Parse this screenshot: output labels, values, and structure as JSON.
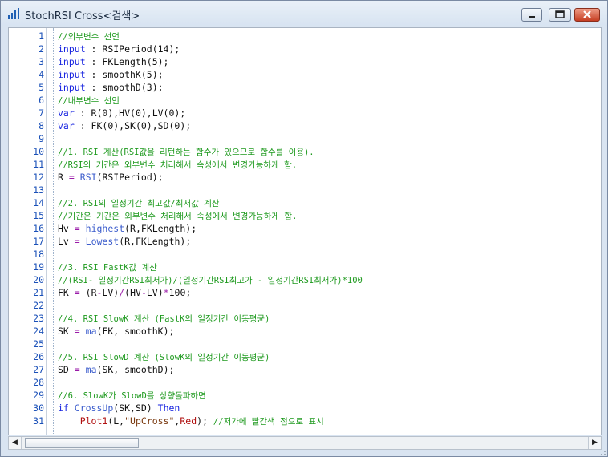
{
  "window": {
    "title": "StochRSI Cross<검색>",
    "icons": {
      "app": "bar-chart-icon",
      "minimize": "minimize-icon",
      "maximize": "maximize-icon",
      "close": "close-icon"
    }
  },
  "editor": {
    "lines": [
      {
        "n": "1",
        "parts": [
          [
            "cm",
            "//외부변수 선언"
          ]
        ]
      },
      {
        "n": "2",
        "parts": [
          [
            "kw",
            "input"
          ],
          [
            "pl",
            " : RSIPeriod(14);"
          ]
        ]
      },
      {
        "n": "3",
        "parts": [
          [
            "kw",
            "input"
          ],
          [
            "pl",
            " : FKLength(5);"
          ]
        ]
      },
      {
        "n": "4",
        "parts": [
          [
            "kw",
            "input"
          ],
          [
            "pl",
            " : smoothK(5);"
          ]
        ]
      },
      {
        "n": "5",
        "parts": [
          [
            "kw",
            "input"
          ],
          [
            "pl",
            " : smoothD(3);"
          ]
        ]
      },
      {
        "n": "6",
        "parts": [
          [
            "cm",
            "//내부변수 선언"
          ]
        ]
      },
      {
        "n": "7",
        "parts": [
          [
            "kw",
            "var"
          ],
          [
            "pl",
            " : R(0),HV(0),LV(0);"
          ]
        ]
      },
      {
        "n": "8",
        "parts": [
          [
            "kw",
            "var"
          ],
          [
            "pl",
            " : FK(0),SK(0),SD(0);"
          ]
        ]
      },
      {
        "n": "9",
        "parts": []
      },
      {
        "n": "10",
        "parts": [
          [
            "cm",
            "//1. RSI 계산(RSI값을 리턴하는 함수가 있으므로 함수를 이용)."
          ]
        ]
      },
      {
        "n": "11",
        "parts": [
          [
            "cm",
            "//RSI의 기간은 외부변수 처리해서 속성에서 변경가능하게 함."
          ]
        ]
      },
      {
        "n": "12",
        "parts": [
          [
            "pl",
            "R "
          ],
          [
            "op",
            "="
          ],
          [
            "pl",
            " "
          ],
          [
            "fn",
            "RSI"
          ],
          [
            "pl",
            "(RSIPeriod);"
          ]
        ]
      },
      {
        "n": "13",
        "parts": []
      },
      {
        "n": "14",
        "parts": [
          [
            "cm",
            "//2. RSI의 일정기간 최고값/최저값 계산"
          ]
        ]
      },
      {
        "n": "15",
        "parts": [
          [
            "cm",
            "//기간은 기간은 외부변수 처리해서 속성에서 변경가능하게 함."
          ]
        ]
      },
      {
        "n": "16",
        "parts": [
          [
            "pl",
            "Hv "
          ],
          [
            "op",
            "="
          ],
          [
            "pl",
            " "
          ],
          [
            "fn",
            "highest"
          ],
          [
            "pl",
            "(R,FKLength);"
          ]
        ]
      },
      {
        "n": "17",
        "parts": [
          [
            "pl",
            "Lv "
          ],
          [
            "op",
            "="
          ],
          [
            "pl",
            " "
          ],
          [
            "fn",
            "Lowest"
          ],
          [
            "pl",
            "(R,FKLength);"
          ]
        ]
      },
      {
        "n": "18",
        "parts": []
      },
      {
        "n": "19",
        "parts": [
          [
            "cm",
            "//3. RSI FastK값 계산"
          ]
        ]
      },
      {
        "n": "20",
        "parts": [
          [
            "cm",
            "//(RSI- 일정기간RSI최저가)/(일정기간RSI최고가 - 일정기간RSI최저가)*100"
          ]
        ]
      },
      {
        "n": "21",
        "parts": [
          [
            "pl",
            "FK "
          ],
          [
            "op",
            "="
          ],
          [
            "pl",
            " (R"
          ],
          [
            "op",
            "-"
          ],
          [
            "pl",
            "LV)"
          ],
          [
            "op",
            "/"
          ],
          [
            "pl",
            "(HV"
          ],
          [
            "op",
            "-"
          ],
          [
            "pl",
            "LV)"
          ],
          [
            "op",
            "*"
          ],
          [
            "pl",
            "100;"
          ]
        ]
      },
      {
        "n": "22",
        "parts": []
      },
      {
        "n": "23",
        "parts": [
          [
            "cm",
            "//4. RSI SlowK 계산 (FastK의 일정기간 이동평균)"
          ]
        ]
      },
      {
        "n": "24",
        "parts": [
          [
            "pl",
            "SK "
          ],
          [
            "op",
            "="
          ],
          [
            "pl",
            " "
          ],
          [
            "fn",
            "ma"
          ],
          [
            "pl",
            "(FK, smoothK);"
          ]
        ]
      },
      {
        "n": "25",
        "parts": []
      },
      {
        "n": "26",
        "parts": [
          [
            "cm",
            "//5. RSI SlowD 계산 (SlowK의 일정기간 이동평균)"
          ]
        ]
      },
      {
        "n": "27",
        "parts": [
          [
            "pl",
            "SD "
          ],
          [
            "op",
            "="
          ],
          [
            "pl",
            " "
          ],
          [
            "fn",
            "ma"
          ],
          [
            "pl",
            "(SK, smoothD);"
          ]
        ]
      },
      {
        "n": "28",
        "parts": []
      },
      {
        "n": "29",
        "parts": [
          [
            "cm",
            "//6. SlowK가 SlowD를 상향돌파하면"
          ]
        ]
      },
      {
        "n": "30",
        "parts": [
          [
            "kw",
            "if"
          ],
          [
            "pl",
            " "
          ],
          [
            "fn",
            "CrossUp"
          ],
          [
            "pl",
            "(SK,SD) "
          ],
          [
            "kw",
            "Then"
          ]
        ]
      },
      {
        "n": "31",
        "parts": [
          [
            "pl",
            "    "
          ],
          [
            "pf",
            "Plot1"
          ],
          [
            "pl",
            "(L,"
          ],
          [
            "str",
            "\"UpCross\""
          ],
          [
            "pl",
            ","
          ],
          [
            "pf",
            "Red"
          ],
          [
            "pl",
            "); "
          ],
          [
            "cm",
            "//저가에 빨간색 점으로 표시"
          ]
        ]
      }
    ]
  },
  "scrollbar": {
    "left_arrow": "◀",
    "right_arrow": "▶"
  }
}
